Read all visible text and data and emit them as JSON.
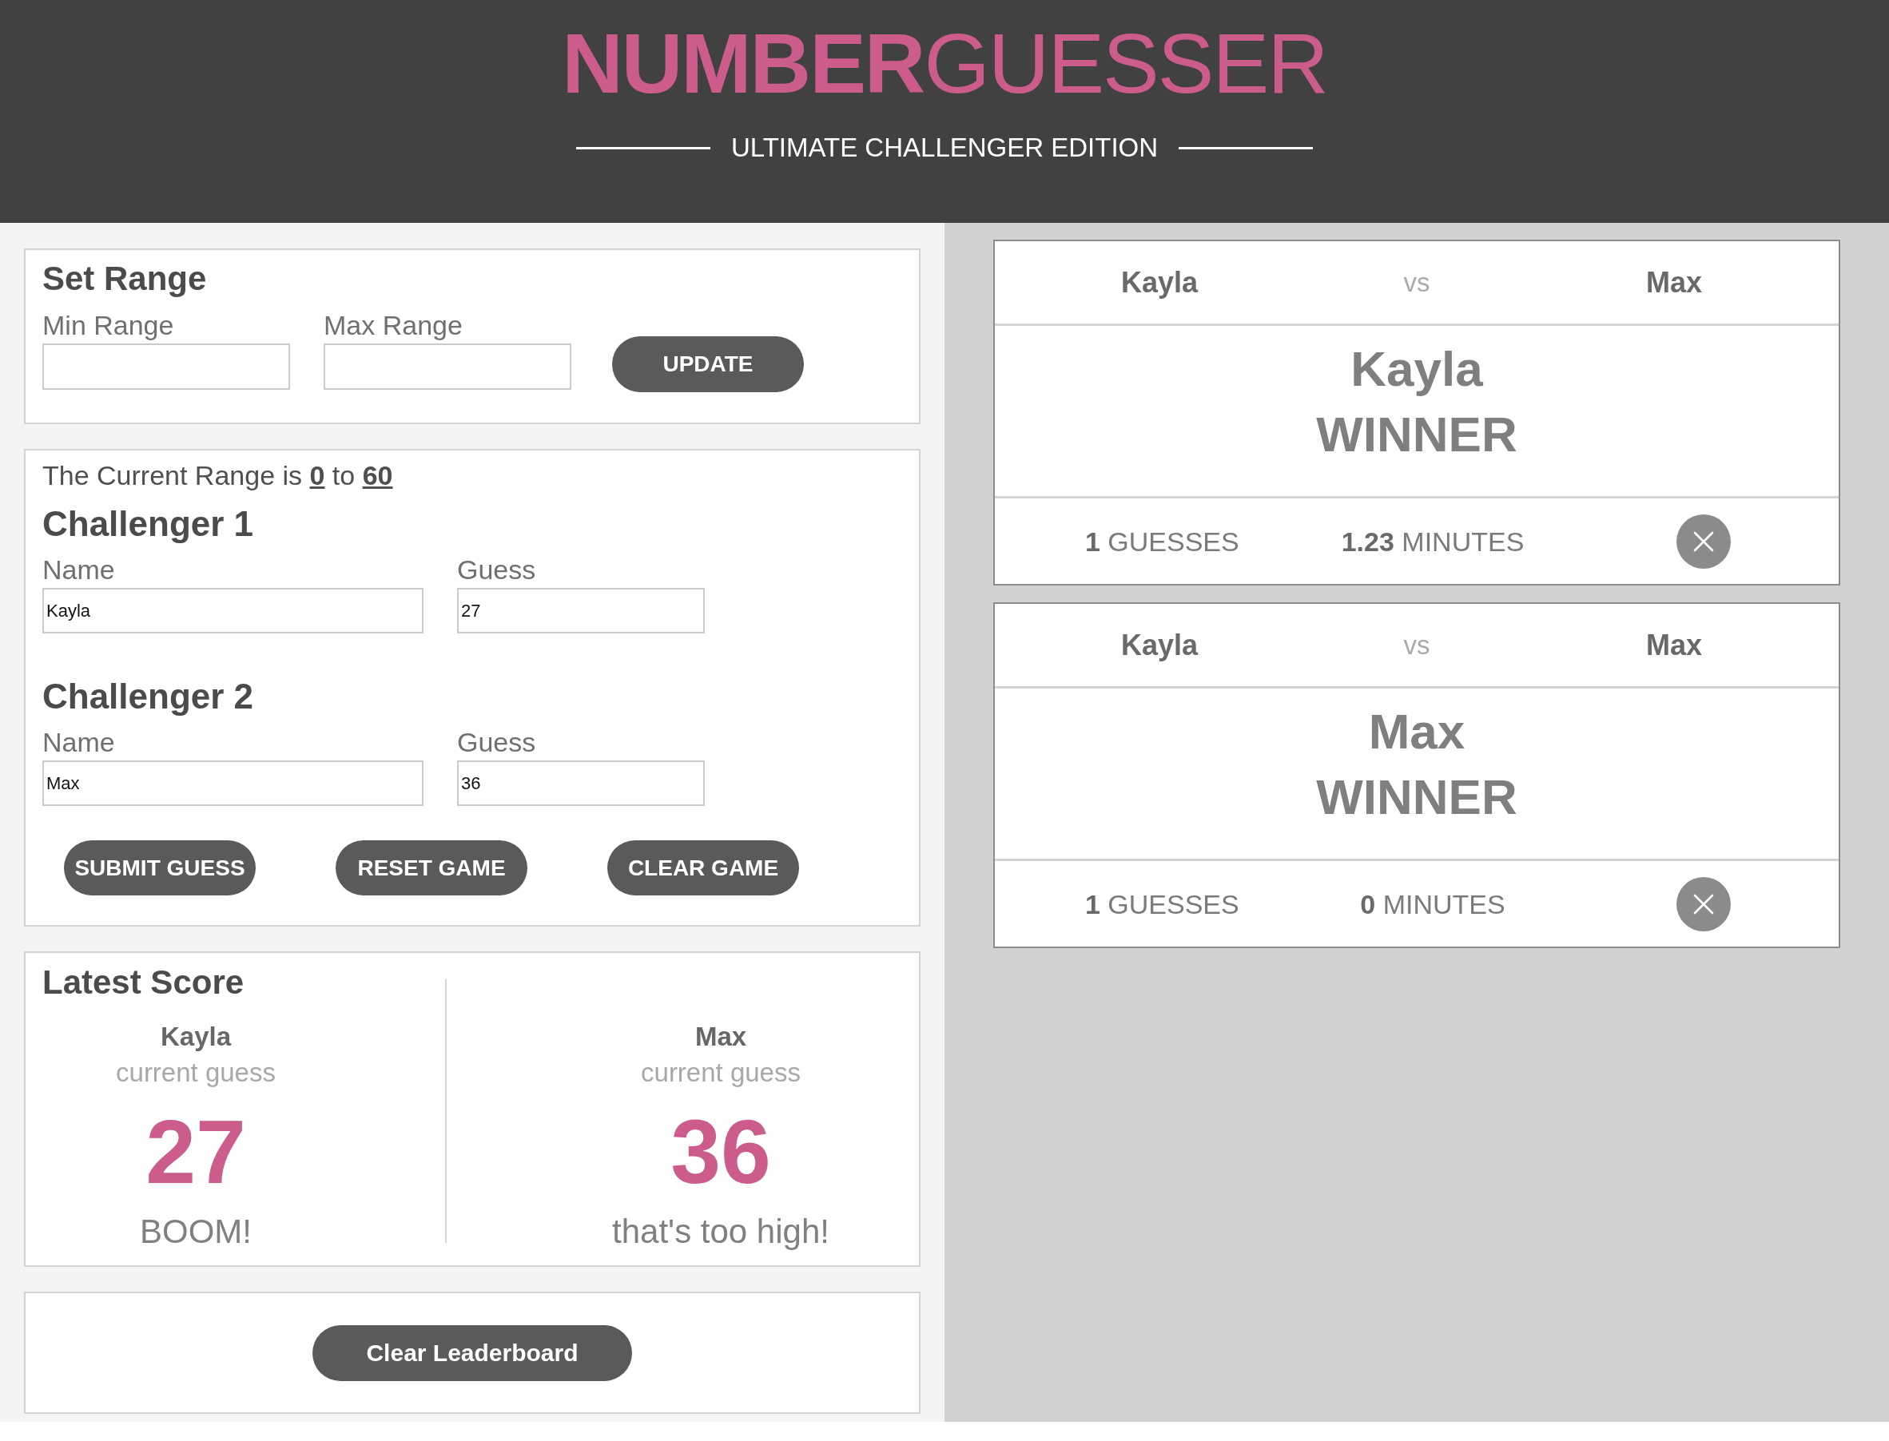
{
  "header": {
    "title": "**NUMBER**GUESSER",
    "subtitle": "ULTIMATE CHALLENGER EDITION"
  },
  "set_range": {
    "title": "Set Range",
    "fields": [
      {
        "label": "Min Range"
      },
      {
        "label": "Max Range"
      }
    ],
    "button": "UPDATE"
  },
  "challenge": {
    "current_range": "The Current Range is **0** to **60**",
    "challengers": [
      {
        "title": "Challenger 1",
        "name_label": "Name",
        "name_value": "Kayla",
        "guess_label": "Guess",
        "guess_value": "27"
      },
      {
        "title": "Challenger 2",
        "name_label": "Name",
        "name_value": "Max",
        "guess_label": "Guess",
        "guess_value": "36"
      }
    ],
    "buttons": [
      "SUBMIT GUESS",
      "RESET GAME",
      "CLEAR GAME"
    ]
  },
  "latest_score": {
    "title": "Latest Score",
    "players": [
      {
        "name": "Kayla",
        "caption": "current guess",
        "guess": "27",
        "feedback": "BOOM!"
      },
      {
        "name": "Max",
        "caption": "current guess",
        "guess": "36",
        "feedback": "that's too high!"
      }
    ]
  },
  "leaderboard": {
    "button": "Clear Leaderboard"
  },
  "results": [
    {
      "player_1": "Kayla",
      "versus": "vs",
      "player_2": "Max",
      "winner": "Kayla",
      "winner_label": "WINNER",
      "guesses": "**1** GUESSES",
      "time": "**1.23** MINUTES"
    },
    {
      "player_1": "Kayla",
      "versus": "vs",
      "player_2": "Max",
      "winner": "Max",
      "winner_label": "WINNER",
      "guesses": "**1** GUESSES",
      "time": "**0** MINUTES"
    }
  ]
}
